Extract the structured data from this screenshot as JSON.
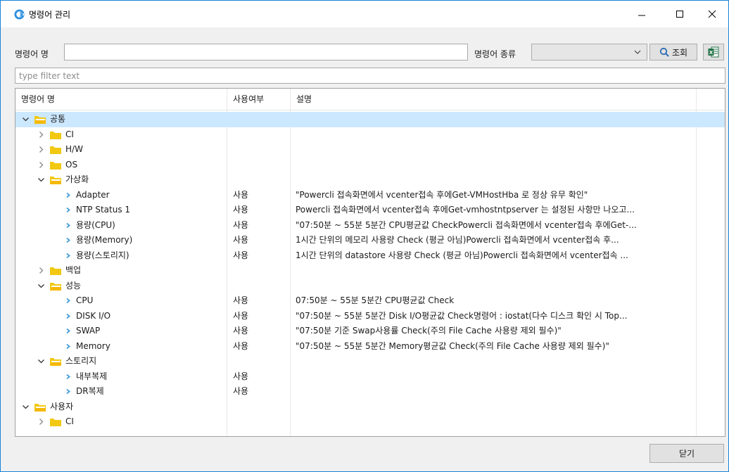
{
  "window": {
    "title": "명령어 관리",
    "controls": {
      "minimize": "—",
      "maximize": "☐",
      "close": "✕"
    }
  },
  "search": {
    "name_label": "명령어 명",
    "name_value": "",
    "type_label": "명령어 종류",
    "type_value": "",
    "search_button": "조회",
    "excel_icon_label": "X"
  },
  "filter": {
    "placeholder": "type filter text"
  },
  "table": {
    "columns": [
      "명령어 명",
      "사용여부",
      "설명"
    ],
    "rows": [
      {
        "kind": "folder",
        "level": 0,
        "expanded": true,
        "label": "공통",
        "use": "",
        "desc": "",
        "selected": true
      },
      {
        "kind": "folder",
        "level": 1,
        "expanded": false,
        "label": "CI",
        "use": "",
        "desc": ""
      },
      {
        "kind": "folder",
        "level": 1,
        "expanded": false,
        "label": "H/W",
        "use": "",
        "desc": ""
      },
      {
        "kind": "folder",
        "level": 1,
        "expanded": false,
        "label": "OS",
        "use": "",
        "desc": ""
      },
      {
        "kind": "folder",
        "level": 1,
        "expanded": true,
        "label": "가상화",
        "use": "",
        "desc": ""
      },
      {
        "kind": "leaf",
        "level": 2,
        "label": "Adapter",
        "use": "사용",
        "desc": "\"Powercli 접속화면에서 vcenter접속 후에Get-VMHostHba 로 정상 유무 확인\""
      },
      {
        "kind": "leaf",
        "level": 2,
        "label": "NTP Status 1",
        "use": "사용",
        "desc": "Powercli 접속화면에서 vcenter접속 후에Get-vmhostntpserver 는 설정된 사항만 나오고..."
      },
      {
        "kind": "leaf",
        "level": 2,
        "label": "용량(CPU)",
        "use": "사용",
        "desc": "\"07:50분 ~ 55분 5분간 CPU평균값 CheckPowercli 접속화면에서 vcenter접속 후에Get-..."
      },
      {
        "kind": "leaf",
        "level": 2,
        "label": "용량(Memory)",
        "use": "사용",
        "desc": "1시간 단위의 메모리 사용량 Check (평균 아님)Powercli 접속화면에서 vcenter접속 후..."
      },
      {
        "kind": "leaf",
        "level": 2,
        "label": "용량(스토리지)",
        "use": "사용",
        "desc": "1시간 단위의 datastore 사용량 Check (평균 아님)Powercli 접속화면에서 vcenter접속 ..."
      },
      {
        "kind": "folder",
        "level": 1,
        "expanded": false,
        "label": "백업",
        "use": "",
        "desc": ""
      },
      {
        "kind": "folder",
        "level": 1,
        "expanded": true,
        "label": "성능",
        "use": "",
        "desc": ""
      },
      {
        "kind": "leaf",
        "level": 2,
        "label": "CPU",
        "use": "사용",
        "desc": "07:50분 ~ 55분 5분간 CPU평균값 Check"
      },
      {
        "kind": "leaf",
        "level": 2,
        "label": "DISK I/O",
        "use": "사용",
        "desc": "\"07:50분 ~ 55분 5분간 Disk I/O평균값 Check명령어 : iostat(다수 디스크 확인 시 Top..."
      },
      {
        "kind": "leaf",
        "level": 2,
        "label": "SWAP",
        "use": "사용",
        "desc": "\"07:50분 기준 Swap사용률 Check(주의 File Cache 사용량 제외 필수)\""
      },
      {
        "kind": "leaf",
        "level": 2,
        "label": "Memory",
        "use": "사용",
        "desc": "\"07:50분 ~ 55분 5분간 Memory평균값 Check(주의 File Cache 사용량 제외 필수)\""
      },
      {
        "kind": "folder",
        "level": 1,
        "expanded": true,
        "label": "스토리지",
        "use": "",
        "desc": ""
      },
      {
        "kind": "leaf",
        "level": 2,
        "label": "내부복제",
        "use": "사용",
        "desc": ""
      },
      {
        "kind": "leaf",
        "level": 2,
        "label": "DR복제",
        "use": "사용",
        "desc": ""
      },
      {
        "kind": "folder",
        "level": 0,
        "expanded": true,
        "label": "사용자",
        "use": "",
        "desc": ""
      },
      {
        "kind": "folder",
        "level": 1,
        "expanded": false,
        "label": "CI",
        "use": "",
        "desc": ""
      }
    ]
  },
  "footer": {
    "close_button": "닫기"
  },
  "colors": {
    "selection": "#cce8ff",
    "folder": "#f2c811",
    "folder_open": "#f5b800",
    "leaf_arrow": "#3c9bd6",
    "border": "#1883d7",
    "excel": "#1e7145"
  }
}
